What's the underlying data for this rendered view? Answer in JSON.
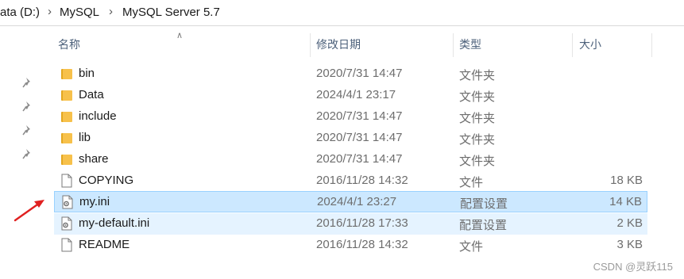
{
  "breadcrumb": {
    "items": [
      "ata (D:)",
      "MySQL",
      "MySQL Server 5.7"
    ]
  },
  "header": {
    "name": "名称",
    "date": "修改日期",
    "type": "类型",
    "size": "大小"
  },
  "files": [
    {
      "name": "bin",
      "date": "2020/7/31 14:47",
      "type": "文件夹",
      "size": "",
      "icon": "folder-icon"
    },
    {
      "name": "Data",
      "date": "2024/4/1 23:17",
      "type": "文件夹",
      "size": "",
      "icon": "folder-icon"
    },
    {
      "name": "include",
      "date": "2020/7/31 14:47",
      "type": "文件夹",
      "size": "",
      "icon": "folder-icon"
    },
    {
      "name": "lib",
      "date": "2020/7/31 14:47",
      "type": "文件夹",
      "size": "",
      "icon": "folder-icon"
    },
    {
      "name": "share",
      "date": "2020/7/31 14:47",
      "type": "文件夹",
      "size": "",
      "icon": "folder-icon"
    },
    {
      "name": "COPYING",
      "date": "2016/11/28 14:32",
      "type": "文件",
      "size": "18 KB",
      "icon": "file-icon"
    },
    {
      "name": "my.ini",
      "date": "2024/4/1 23:27",
      "type": "配置设置",
      "size": "14 KB",
      "icon": "config-file-icon"
    },
    {
      "name": "my-default.ini",
      "date": "2016/11/28 17:33",
      "type": "配置设置",
      "size": "2 KB",
      "icon": "config-file-icon"
    },
    {
      "name": "README",
      "date": "2016/11/28 14:32",
      "type": "文件",
      "size": "3 KB",
      "icon": "file-icon"
    }
  ],
  "colors": {
    "selected_bg": "#cce8ff",
    "hover_bg": "#e5f3ff",
    "arrow": "#e02020",
    "folder": "#f7c14b"
  },
  "watermark": "CSDN @灵跃115"
}
